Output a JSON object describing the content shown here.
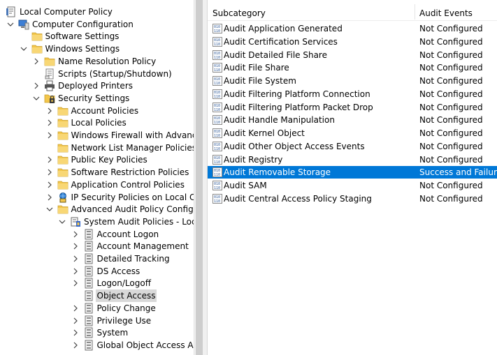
{
  "tree": {
    "nodes": [
      {
        "label": "Local Computer Policy",
        "icon": "policy-icon",
        "expander": "none",
        "selected": false
      },
      {
        "label": "Computer Configuration",
        "icon": "computer-icon",
        "expander": "expanded",
        "selected": false
      },
      {
        "label": "Software Settings",
        "icon": "folder-icon",
        "expander": "none",
        "selected": false
      },
      {
        "label": "Windows Settings",
        "icon": "folder-icon",
        "expander": "expanded",
        "selected": false
      },
      {
        "label": "Name Resolution Policy",
        "icon": "folder-icon",
        "expander": "collapsed",
        "selected": false
      },
      {
        "label": "Scripts (Startup/Shutdown)",
        "icon": "script-icon",
        "expander": "none",
        "selected": false
      },
      {
        "label": "Deployed Printers",
        "icon": "printer-icon",
        "expander": "collapsed",
        "selected": false
      },
      {
        "label": "Security Settings",
        "icon": "security-icon",
        "expander": "expanded",
        "selected": false
      },
      {
        "label": "Account Policies",
        "icon": "folder-icon",
        "expander": "collapsed",
        "selected": false
      },
      {
        "label": "Local Policies",
        "icon": "folder-icon",
        "expander": "collapsed",
        "selected": false
      },
      {
        "label": "Windows Firewall with Advanced",
        "icon": "folder-icon",
        "expander": "collapsed",
        "selected": false
      },
      {
        "label": "Network List Manager Policies",
        "icon": "folder-icon",
        "expander": "none",
        "selected": false
      },
      {
        "label": "Public Key Policies",
        "icon": "folder-icon",
        "expander": "collapsed",
        "selected": false
      },
      {
        "label": "Software Restriction Policies",
        "icon": "folder-icon",
        "expander": "collapsed",
        "selected": false
      },
      {
        "label": "Application Control Policies",
        "icon": "folder-icon",
        "expander": "collapsed",
        "selected": false
      },
      {
        "label": "IP Security Policies on Local Com",
        "icon": "ipsec-icon",
        "expander": "collapsed",
        "selected": false
      },
      {
        "label": "Advanced Audit Policy Configura",
        "icon": "folder-icon",
        "expander": "expanded",
        "selected": false
      },
      {
        "label": "System Audit Policies - Local",
        "icon": "audit-policy-icon",
        "expander": "expanded",
        "selected": false
      },
      {
        "label": "Account Logon",
        "icon": "audit-category-icon",
        "expander": "collapsed",
        "selected": false
      },
      {
        "label": "Account Management",
        "icon": "audit-category-icon",
        "expander": "collapsed",
        "selected": false
      },
      {
        "label": "Detailed Tracking",
        "icon": "audit-category-icon",
        "expander": "collapsed",
        "selected": false
      },
      {
        "label": "DS Access",
        "icon": "audit-category-icon",
        "expander": "collapsed",
        "selected": false
      },
      {
        "label": "Logon/Logoff",
        "icon": "audit-category-icon",
        "expander": "collapsed",
        "selected": false
      },
      {
        "label": "Object Access",
        "icon": "audit-category-icon",
        "expander": "none",
        "selected": true
      },
      {
        "label": "Policy Change",
        "icon": "audit-category-icon",
        "expander": "collapsed",
        "selected": false
      },
      {
        "label": "Privilege Use",
        "icon": "audit-category-icon",
        "expander": "collapsed",
        "selected": false
      },
      {
        "label": "System",
        "icon": "audit-category-icon",
        "expander": "collapsed",
        "selected": false
      },
      {
        "label": "Global Object Access Aud",
        "icon": "audit-category-icon",
        "expander": "collapsed",
        "selected": false
      }
    ]
  },
  "list": {
    "columns": {
      "subcategory": "Subcategory",
      "audit_events": "Audit Events"
    },
    "rows": [
      {
        "subcategory": "Audit Application Generated",
        "audit_events": "Not Configured",
        "selected": false
      },
      {
        "subcategory": "Audit Certification Services",
        "audit_events": "Not Configured",
        "selected": false
      },
      {
        "subcategory": "Audit Detailed File Share",
        "audit_events": "Not Configured",
        "selected": false
      },
      {
        "subcategory": "Audit File Share",
        "audit_events": "Not Configured",
        "selected": false
      },
      {
        "subcategory": "Audit File System",
        "audit_events": "Not Configured",
        "selected": false
      },
      {
        "subcategory": "Audit Filtering Platform Connection",
        "audit_events": "Not Configured",
        "selected": false
      },
      {
        "subcategory": "Audit Filtering Platform Packet Drop",
        "audit_events": "Not Configured",
        "selected": false
      },
      {
        "subcategory": "Audit Handle Manipulation",
        "audit_events": "Not Configured",
        "selected": false
      },
      {
        "subcategory": "Audit Kernel Object",
        "audit_events": "Not Configured",
        "selected": false
      },
      {
        "subcategory": "Audit Other Object Access Events",
        "audit_events": "Not Configured",
        "selected": false
      },
      {
        "subcategory": "Audit Registry",
        "audit_events": "Not Configured",
        "selected": false
      },
      {
        "subcategory": "Audit Removable Storage",
        "audit_events": "Success and Failure",
        "selected": true
      },
      {
        "subcategory": "Audit SAM",
        "audit_events": "Not Configured",
        "selected": false
      },
      {
        "subcategory": "Audit Central Access Policy Staging",
        "audit_events": "Not Configured",
        "selected": false
      }
    ]
  },
  "colors": {
    "selection_blue": "#0078d7",
    "tree_selection_gray": "#d9d9d9",
    "folder_yellow": "#f3c64b"
  }
}
